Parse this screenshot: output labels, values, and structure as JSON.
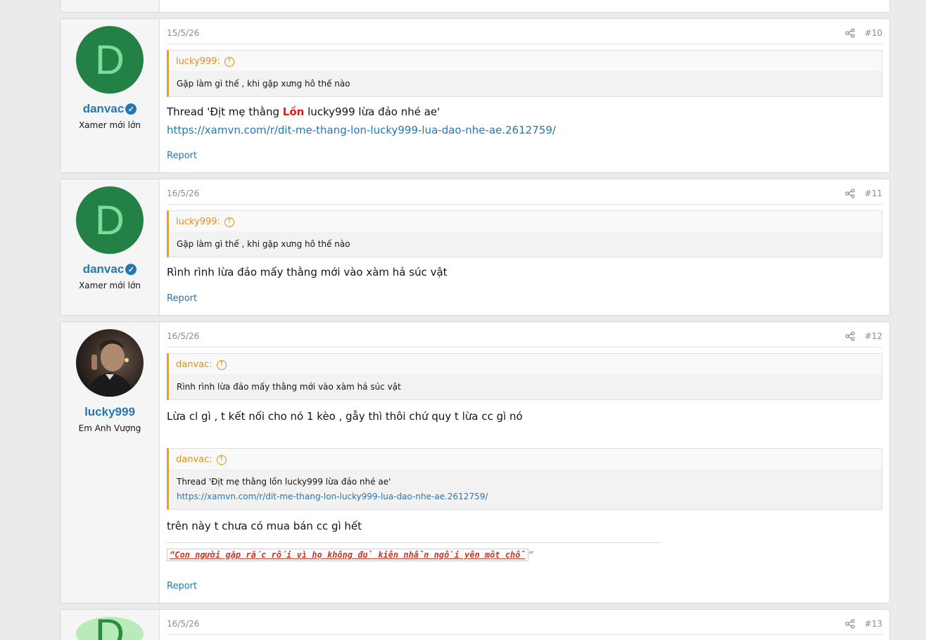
{
  "posts": [
    {
      "user": {
        "initial": "D",
        "name": "danvac",
        "title": "Xamer mới lớn"
      },
      "date": "15/5/26",
      "number": "#10",
      "quote": {
        "author": "lucky999:",
        "text": "Gặp làm gì thế , khi gặp xưng hô thế nào"
      },
      "body": {
        "pre": "Thread 'Địt mẹ thằng ",
        "bold": "Lồn",
        "post": " lucky999 lừa đảo nhé ae'",
        "link": "https://xamvn.com/r/dit-me-thang-lon-lucky999-lua-dao-nhe-ae.2612759/"
      },
      "report": "Report"
    },
    {
      "user": {
        "initial": "D",
        "name": "danvac",
        "title": "Xamer mới lớn"
      },
      "date": "16/5/26",
      "number": "#11",
      "quote": {
        "author": "lucky999:",
        "text": "Gặp làm gì thế , khi gặp xưng hô thế nào"
      },
      "body": {
        "text": "Rình rình lừa đảo mấy thằng mới vào xàm hả súc vật"
      },
      "report": "Report"
    },
    {
      "user": {
        "name": "lucky999",
        "title": "Em Anh Vượng"
      },
      "date": "16/5/26",
      "number": "#12",
      "quote": {
        "author": "danvac:",
        "text": "Rình rình lừa đảo mấy thằng mới vào xàm hả súc vật"
      },
      "body": {
        "text": "Lừa cl gì , t kết nối cho nó 1 kèo , gẫy thì thôi chứ quy t lừa cc gì nó"
      },
      "quote2": {
        "author": "danvac:",
        "text": "Thread 'Địt mẹ thằng lồn lucky999 lừa đảo nhé ae'",
        "link": "https://xamvn.com/r/dit-me-thang-lon-lucky999-lua-dao-nhe-ae.2612759/"
      },
      "body2": {
        "text": "trên này t chưa có mua bán cc gì hết"
      },
      "signature": {
        "open": "“",
        "text": "Con người gặp rắc rối vì họ không đủ kiên nhẫn ngồi yên một chỗ",
        "close": "”"
      },
      "report": "Report"
    },
    {
      "user": {
        "initial": "D"
      },
      "date": "16/5/26",
      "number": "#13"
    }
  ]
}
